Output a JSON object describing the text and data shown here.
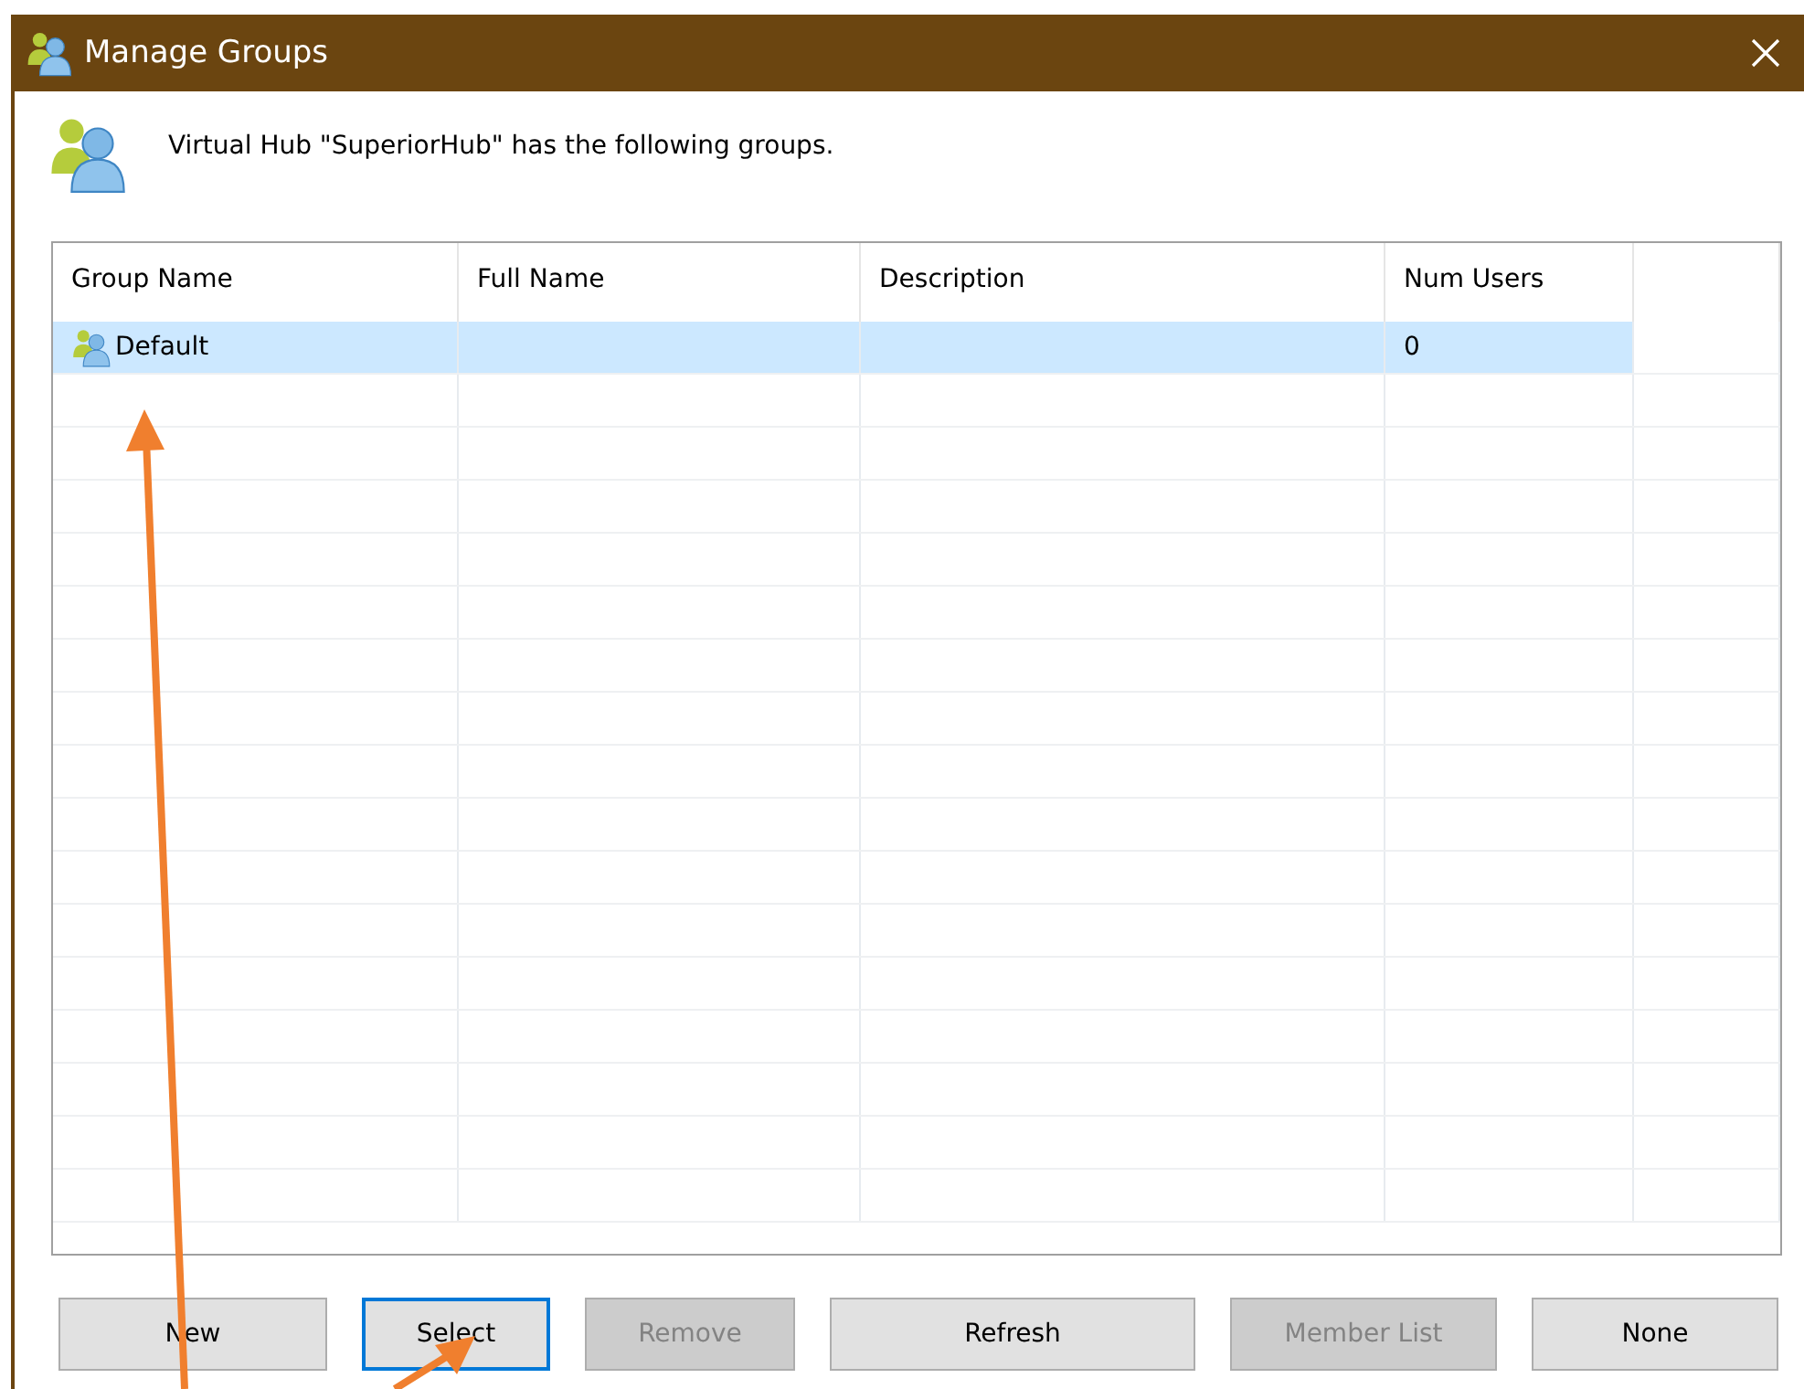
{
  "window": {
    "title": "Manage Groups"
  },
  "message": "Virtual Hub \"SuperiorHub\" has the following groups.",
  "table": {
    "columns": [
      "Group Name",
      "Full Name",
      "Description",
      "Num Users"
    ],
    "rows": [
      {
        "group_name": "Default",
        "num_users": "0",
        "selected": true
      }
    ]
  },
  "buttons": [
    {
      "label": "New",
      "disabled": false,
      "focused": false
    },
    {
      "label": "Select",
      "disabled": false,
      "focused": true
    },
    {
      "label": "Remove",
      "disabled": true,
      "focused": false
    },
    {
      "label": "Refresh",
      "disabled": false,
      "focused": false
    },
    {
      "label": "Member List",
      "disabled": true,
      "focused": false
    },
    {
      "label": "None",
      "disabled": false,
      "focused": false
    }
  ]
}
